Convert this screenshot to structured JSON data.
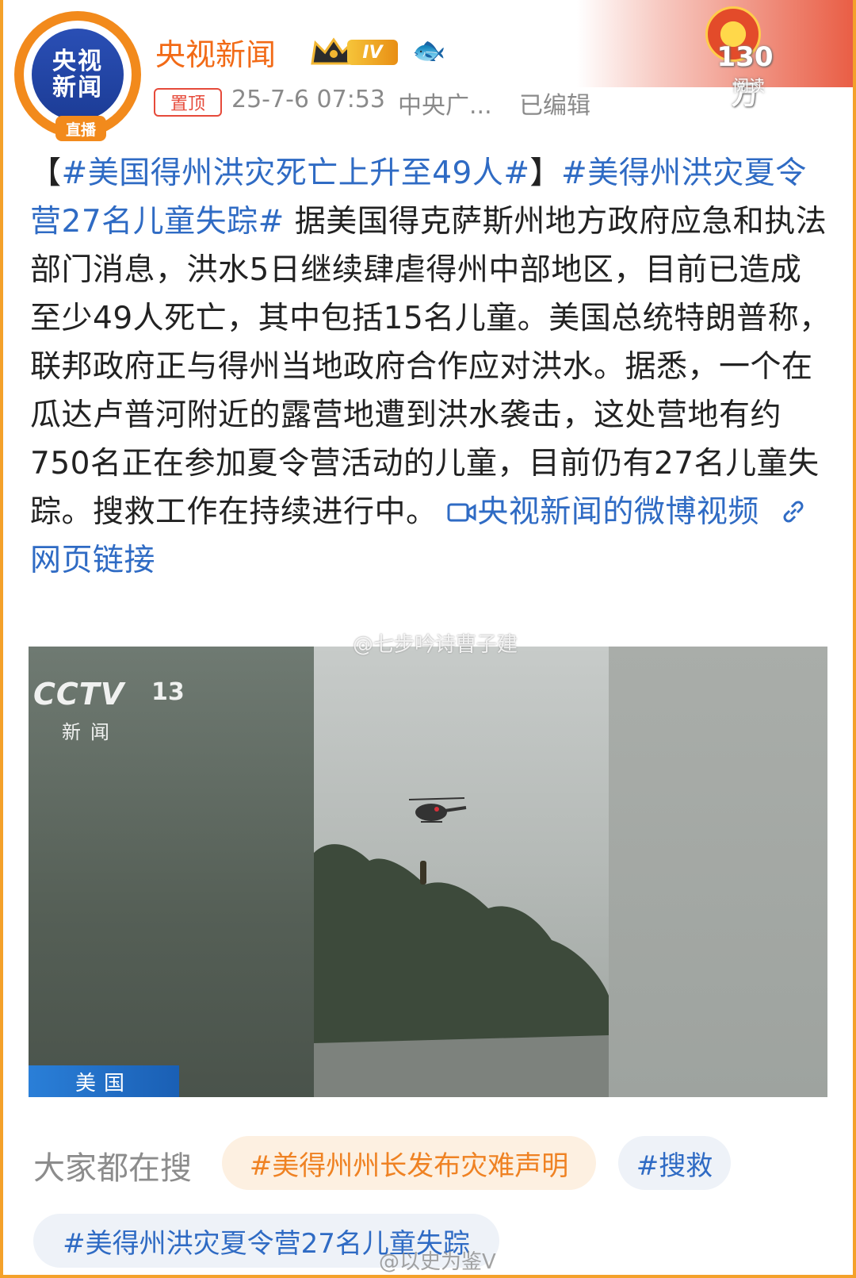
{
  "header": {
    "avatar_line1": "央视",
    "avatar_line2": "新闻",
    "avatar_live": "直播",
    "author": "央视新闻",
    "level": "IV",
    "pinned_label": "置顶",
    "timestamp": "25-7-6 07:53",
    "source": "中央广...",
    "edited": "已编辑",
    "reads_count": "130万",
    "reads_label": "阅读"
  },
  "post": {
    "bracket_open": "【",
    "tag1": "#美国得州洪灾死亡上升至49人#",
    "bracket_close": "】",
    "tag2": "#美得州洪灾夏令营27名儿童失踪#",
    "body": " 据美国得克萨斯州地方政府应急和执法部门消息，洪水5日继续肆虐得州中部地区，目前已造成至少49人死亡，其中包括15名儿童。美国总统特朗普称，联邦政府正与得州当地政府合作应对洪水。据悉，一个在瓜达卢普河附近的露营地遭到洪水袭击，这处营地有约750名正在参加夏令营活动的儿童，目前仍有27名儿童失踪。搜救工作在持续进行中。",
    "video_link": "央视新闻的微博视频",
    "web_link": "网页链接"
  },
  "video": {
    "channel_logo": "CCTV",
    "channel_number": "13",
    "channel_sub": "新闻",
    "location_tag": "美国"
  },
  "watermarks": {
    "top": "@七步吟诗曹子建",
    "bottom": "@以史为鉴V"
  },
  "search": {
    "label": "大家都在搜",
    "chips": [
      "#美得州州长发布灾难声明",
      "#搜救",
      "#美得州洪灾夏令营27名儿童失踪"
    ]
  },
  "colors": {
    "author": "#f26a16",
    "link": "#2f6bc4",
    "pin": "#e64a3a",
    "chip_hot_bg": "#fdf0e1",
    "chip_hot_text": "#ef8223"
  },
  "icons": [
    "crown-icon",
    "fish-icon",
    "video-icon",
    "link-icon",
    "weibo-icon"
  ]
}
